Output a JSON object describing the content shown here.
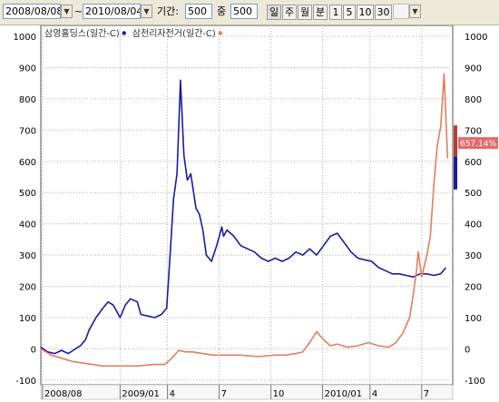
{
  "toolbar": {
    "date_from": "2008/08/08",
    "date_to": "2010/08/04",
    "tilde": "~",
    "period_label": "기간:",
    "period_value": "500",
    "of_label": "중",
    "total_value": "500",
    "buttons": [
      "일",
      "주",
      "월",
      "분",
      "1",
      "5",
      "10",
      "30"
    ],
    "active_button": "일"
  },
  "chart_data": {
    "type": "line",
    "legend": [
      {
        "label": "삼영홀딩스(일간-C)",
        "color": "#1a1aa6"
      },
      {
        "label": "삼천리자전거(일간-C)",
        "color": "#e07f5e"
      }
    ],
    "y_ticks": [
      -100,
      0,
      100,
      200,
      300,
      400,
      500,
      600,
      700,
      800,
      900,
      1000
    ],
    "ylim": [
      -115,
      1035
    ],
    "x_labels": [
      "2008/08",
      "2009/01",
      "4",
      "7",
      "10",
      "2010/01",
      "4",
      "7"
    ],
    "x_label_positions": [
      0.5,
      5,
      7.75,
      10.75,
      13.75,
      16.75,
      19.5,
      22.5
    ],
    "xlim": [
      0.4,
      24.3
    ],
    "current_value_label": "657.14%",
    "grid": true,
    "series": [
      {
        "name": "삼영홀딩스(일간-C)",
        "color": "#1a1aa6",
        "x": [
          0.4,
          0.8,
          1.2,
          1.6,
          2.0,
          2.4,
          2.7,
          3.0,
          3.2,
          3.6,
          4.0,
          4.3,
          4.6,
          5.0,
          5.3,
          5.6,
          6.0,
          6.2,
          6.6,
          7.0,
          7.4,
          7.7,
          7.9,
          8.1,
          8.3,
          8.5,
          8.7,
          8.9,
          9.1,
          9.4,
          9.6,
          9.8,
          10.0,
          10.3,
          10.6,
          10.9,
          11.0,
          11.2,
          11.6,
          12.0,
          12.4,
          12.8,
          13.2,
          13.6,
          14.0,
          14.4,
          14.8,
          15.2,
          15.6,
          16.0,
          16.4,
          16.8,
          17.2,
          17.6,
          18.0,
          18.4,
          18.8,
          19.2,
          19.6,
          20.0,
          20.4,
          20.8,
          21.2,
          21.6,
          22.0,
          22.4,
          22.8,
          23.2,
          23.6,
          23.9
        ],
        "y": [
          5,
          -10,
          -15,
          -5,
          -15,
          0,
          10,
          30,
          60,
          100,
          130,
          150,
          140,
          100,
          140,
          160,
          150,
          110,
          105,
          100,
          110,
          130,
          300,
          480,
          560,
          860,
          620,
          540,
          560,
          450,
          430,
          380,
          300,
          280,
          330,
          390,
          360,
          380,
          360,
          330,
          320,
          310,
          290,
          280,
          290,
          280,
          290,
          310,
          300,
          320,
          300,
          330,
          360,
          370,
          340,
          310,
          290,
          285,
          280,
          260,
          250,
          240,
          240,
          235,
          230,
          240,
          240,
          235,
          240,
          260
        ]
      },
      {
        "name": "삼천리자전거(일간-C)",
        "color": "#e07f5e",
        "x": [
          0.4,
          1.0,
          1.6,
          2.2,
          2.8,
          3.4,
          4.0,
          5.0,
          6.0,
          7.0,
          7.6,
          8.0,
          8.4,
          8.8,
          9.2,
          9.8,
          10.4,
          11.0,
          12.0,
          13.0,
          14.0,
          14.6,
          15.2,
          15.6,
          16.0,
          16.4,
          16.8,
          17.2,
          17.6,
          18.2,
          18.8,
          19.4,
          20.0,
          20.6,
          21.0,
          21.4,
          21.8,
          22.0,
          22.2,
          22.3,
          22.5,
          22.8,
          23.0,
          23.2,
          23.4,
          23.6,
          23.8,
          24.0
        ],
        "y": [
          0,
          -20,
          -30,
          -40,
          -45,
          -50,
          -55,
          -55,
          -55,
          -50,
          -50,
          -30,
          -5,
          -10,
          -10,
          -15,
          -20,
          -20,
          -20,
          -25,
          -20,
          -20,
          -15,
          -10,
          20,
          55,
          30,
          10,
          15,
          5,
          10,
          20,
          10,
          5,
          20,
          50,
          100,
          170,
          250,
          310,
          230,
          300,
          360,
          520,
          650,
          710,
          880,
          610
        ]
      }
    ]
  }
}
